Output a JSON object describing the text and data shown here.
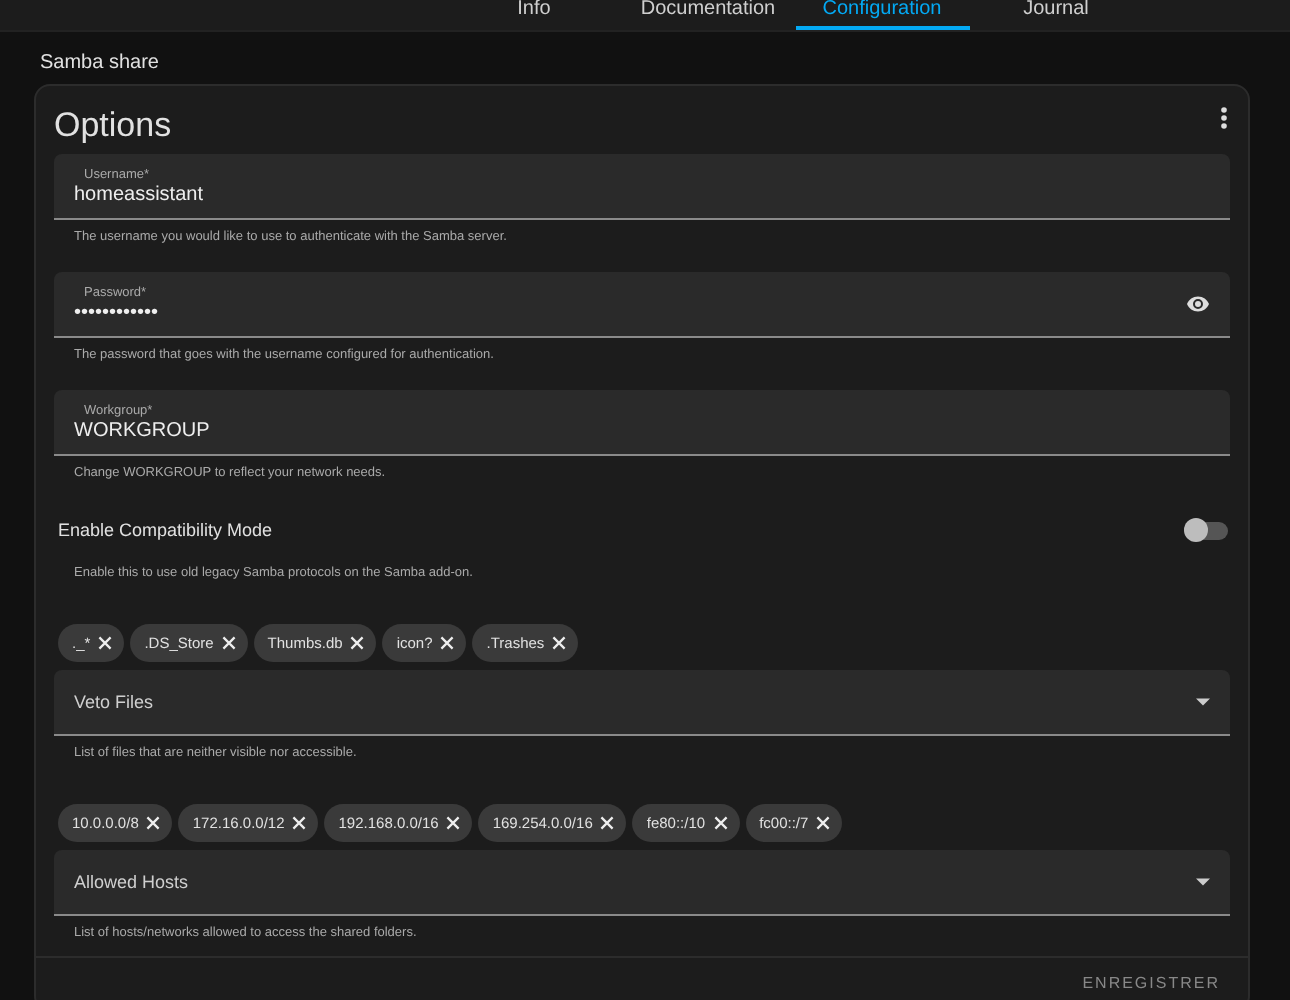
{
  "tabs": [
    {
      "label": "Info",
      "selected": false
    },
    {
      "label": "Documentation",
      "selected": false
    },
    {
      "label": "Configuration",
      "selected": true
    },
    {
      "label": "Journal",
      "selected": false
    }
  ],
  "section_title": "Samba share",
  "card": {
    "title": "Options",
    "fields": [
      {
        "kind": "text",
        "label": "Username*",
        "value": "homeassistant",
        "helper": "The username you would like to use to authenticate with the Samba server."
      },
      {
        "kind": "password",
        "label": "Password*",
        "value": "••••••••••••",
        "helper": "The password that goes with the username configured for authentication."
      },
      {
        "kind": "text",
        "label": "Workgroup*",
        "value": "WORKGROUP",
        "helper": "Change WORKGROUP to reflect your network needs."
      },
      {
        "kind": "toggle",
        "label": "Enable Compatibility Mode",
        "on": false,
        "helper": "Enable this to use old legacy Samba protocols on the Samba add-on."
      },
      {
        "kind": "select",
        "label": "Veto Files",
        "chips": [
          "._*",
          ".DS_Store",
          "Thumbs.db",
          "icon?",
          ".Trashes"
        ],
        "helper": "List of files that are neither visible nor accessible."
      },
      {
        "kind": "select",
        "label": "Allowed Hosts",
        "chips": [
          "10.0.0.0/8",
          "172.16.0.0/12",
          "192.168.0.0/16",
          "169.254.0.0/16",
          "fe80::/10",
          "fc00::/7"
        ],
        "helper": "List of hosts/networks allowed to access the shared folders."
      }
    ],
    "save_button": "ENREGISTRER"
  }
}
